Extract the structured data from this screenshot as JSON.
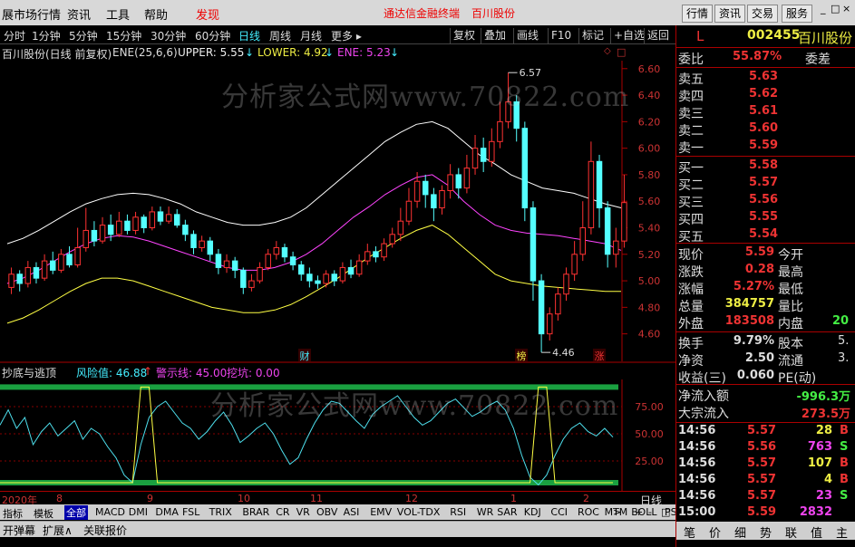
{
  "menubar": {
    "items": [
      "展市场行情",
      "资讯",
      "工具",
      "帮助"
    ],
    "discover": "发现",
    "terminal": "通达信金融终端",
    "stock_name": "百川股份",
    "right_buttons": [
      "行情",
      "资讯",
      "交易",
      "服务"
    ],
    "window_icons": [
      "_",
      "□",
      "×"
    ]
  },
  "periods": {
    "items": [
      "分时",
      "1分钟",
      "5分钟",
      "15分钟",
      "30分钟",
      "60分钟",
      "日线",
      "周线",
      "月线",
      "更多 ▸"
    ],
    "selected": "日线",
    "tools": [
      "复权",
      "叠加",
      "画线",
      "F10",
      "标记",
      "+自选",
      "返回"
    ]
  },
  "infobar": {
    "title": "百川股份(日线 前复权)",
    "indicator": "ENE(25,6,6)",
    "upper": "UPPER: 5.55",
    "lower": "LOWER: 4.92",
    "ene": "ENE: 5.23",
    "arrow": "↓"
  },
  "watermark": "分析家公式网www.70822.com",
  "sub_indicator": {
    "name": "抄底与逃顶",
    "risk": "风险值: 46.88",
    "risk_arrow": "↑",
    "warn": "警示线: 45.00",
    "dig": "挖坑: 0.00"
  },
  "dates": {
    "year": "2020年",
    "months": [
      "8",
      "9",
      "10",
      "11",
      "12",
      "1",
      "2"
    ],
    "period_label": "日线"
  },
  "indicators": [
    "指标",
    "模板",
    "全部",
    "MACD",
    "DMI",
    "DMA",
    "FSL",
    "TRIX",
    "BRAR",
    "CR",
    "VR",
    "OBV",
    "ASI",
    "EMV",
    "VOL-TDX",
    "RSI",
    "WR",
    "SAR",
    "KDJ",
    "CCI",
    "ROC",
    "MTM",
    "BOLL",
    "PSY"
  ],
  "indicator_selected": "全部",
  "indicator_nav": [
    ">",
    "+",
    "-",
    "□"
  ],
  "bottom_tabs": [
    "开弹幕",
    "扩展∧",
    "关联报价"
  ],
  "quote": {
    "mark": "L",
    "code": "002455",
    "name": "百川股份",
    "webi_label": "委比",
    "webi_value": "55.87%",
    "wecha_label": "委差",
    "sell": [
      [
        "卖五",
        "5.63"
      ],
      [
        "卖四",
        "5.62"
      ],
      [
        "卖三",
        "5.61"
      ],
      [
        "卖二",
        "5.60"
      ],
      [
        "卖一",
        "5.59"
      ]
    ],
    "buy": [
      [
        "买一",
        "5.58"
      ],
      [
        "买二",
        "5.57"
      ],
      [
        "买三",
        "5.56"
      ],
      [
        "买四",
        "5.55"
      ],
      [
        "买五",
        "5.54"
      ]
    ],
    "stats": [
      [
        "现价",
        "5.59",
        "今开",
        ""
      ],
      [
        "涨跌",
        "0.28",
        "最高",
        ""
      ],
      [
        "涨幅",
        "5.27%",
        "最低",
        ""
      ],
      [
        "总量",
        "384757",
        "量比",
        ""
      ],
      [
        "外盘",
        "183508",
        "内盘",
        "20"
      ]
    ],
    "stats2": [
      [
        "换手",
        "9.79%",
        "股本",
        "5."
      ],
      [
        "净资",
        "2.50",
        "流通",
        "3."
      ],
      [
        "收益(三)",
        "0.060",
        "PE(动)",
        ""
      ]
    ],
    "flows": [
      [
        "净流入额",
        "-996.3万"
      ],
      [
        "大宗流入",
        "273.5万"
      ]
    ],
    "ticks": [
      [
        "14:56",
        "5.57",
        "28",
        "B"
      ],
      [
        "14:56",
        "5.56",
        "763",
        "S"
      ],
      [
        "14:56",
        "5.57",
        "107",
        "B"
      ],
      [
        "14:56",
        "5.57",
        "4",
        "B"
      ],
      [
        "14:56",
        "5.57",
        "23",
        "S"
      ],
      [
        "15:00",
        "5.59",
        "2832",
        ""
      ]
    ],
    "bottom_tabs": [
      "笔",
      "价",
      "细",
      "势",
      "联",
      "值",
      "主"
    ]
  },
  "chart_data": [
    {
      "type": "candlestick",
      "title": "百川股份(日线 前复权)",
      "y_ticks": [
        4.6,
        4.8,
        5.0,
        5.2,
        5.4,
        5.6,
        5.8,
        6.0,
        6.2,
        6.4,
        6.6
      ],
      "ylim": [
        4.42,
        6.66
      ],
      "annotations": [
        {
          "label": "6.57",
          "value": 6.57
        },
        {
          "label": "4.46",
          "value": 4.46
        }
      ],
      "markers": [
        "财",
        "榜",
        "涨"
      ],
      "candles": [
        [
          4.95,
          5.05,
          5.1,
          4.9
        ],
        [
          5.05,
          4.98,
          5.08,
          4.92
        ],
        [
          4.98,
          5.1,
          5.15,
          4.95
        ],
        [
          5.1,
          5.02,
          5.14,
          4.98
        ],
        [
          5.02,
          5.15,
          5.2,
          5.0
        ],
        [
          5.15,
          5.08,
          5.22,
          5.05
        ],
        [
          5.08,
          5.2,
          5.24,
          5.06
        ],
        [
          5.2,
          5.12,
          5.26,
          5.1
        ],
        [
          5.12,
          5.25,
          5.4,
          5.1
        ],
        [
          5.25,
          5.38,
          5.55,
          5.22
        ],
        [
          5.38,
          5.3,
          5.45,
          5.26
        ],
        [
          5.3,
          5.42,
          5.48,
          5.28
        ],
        [
          5.42,
          5.35,
          5.5,
          5.3
        ],
        [
          5.35,
          5.45,
          5.52,
          5.33
        ],
        [
          5.45,
          5.38,
          5.5,
          5.35
        ],
        [
          5.38,
          5.48,
          5.52,
          5.35
        ],
        [
          5.48,
          5.4,
          5.5,
          5.36
        ],
        [
          5.4,
          5.52,
          5.56,
          5.38
        ],
        [
          5.52,
          5.45,
          5.56,
          5.42
        ],
        [
          5.45,
          5.5,
          5.56,
          5.43
        ],
        [
          5.5,
          5.42,
          5.54,
          5.4
        ],
        [
          5.42,
          5.35,
          5.46,
          5.3
        ],
        [
          5.35,
          5.25,
          5.38,
          5.2
        ],
        [
          5.25,
          5.3,
          5.34,
          5.22
        ],
        [
          5.3,
          5.2,
          5.33,
          5.15
        ],
        [
          5.2,
          5.1,
          5.24,
          5.05
        ],
        [
          5.1,
          5.15,
          5.2,
          5.06
        ],
        [
          5.15,
          5.08,
          5.18,
          5.02
        ],
        [
          5.08,
          4.95,
          5.1,
          4.9
        ],
        [
          4.95,
          5.0,
          5.05,
          4.92
        ],
        [
          5.0,
          5.1,
          5.14,
          4.98
        ],
        [
          5.1,
          5.2,
          5.24,
          5.08
        ],
        [
          5.2,
          5.25,
          5.3,
          5.16
        ],
        [
          5.25,
          5.18,
          5.28,
          5.14
        ],
        [
          5.18,
          5.12,
          5.22,
          5.08
        ],
        [
          5.12,
          5.05,
          5.15,
          5.0
        ],
        [
          5.05,
          5.0,
          5.1,
          4.95
        ],
        [
          5.0,
          4.98,
          5.04,
          4.94
        ],
        [
          4.98,
          5.05,
          5.08,
          4.95
        ],
        [
          5.05,
          5.0,
          5.08,
          4.96
        ],
        [
          5.0,
          5.1,
          5.14,
          4.98
        ],
        [
          5.1,
          5.05,
          5.16,
          5.02
        ],
        [
          5.05,
          5.15,
          5.2,
          5.03
        ],
        [
          5.15,
          5.22,
          5.28,
          5.12
        ],
        [
          5.22,
          5.18,
          5.26,
          5.14
        ],
        [
          5.18,
          5.28,
          5.32,
          5.15
        ],
        [
          5.28,
          5.35,
          5.4,
          5.25
        ],
        [
          5.35,
          5.45,
          5.55,
          5.3
        ],
        [
          5.45,
          5.6,
          5.7,
          5.42
        ],
        [
          5.6,
          5.75,
          5.82,
          5.55
        ],
        [
          5.75,
          5.65,
          5.8,
          5.55
        ],
        [
          5.65,
          5.55,
          5.7,
          5.45
        ],
        [
          5.55,
          5.68,
          5.72,
          5.5
        ],
        [
          5.68,
          5.8,
          5.88,
          5.62
        ],
        [
          5.8,
          5.7,
          5.85,
          5.62
        ],
        [
          5.7,
          5.85,
          5.95,
          5.66
        ],
        [
          5.85,
          6.0,
          6.1,
          5.8
        ],
        [
          6.0,
          5.9,
          6.08,
          5.82
        ],
        [
          5.9,
          6.05,
          6.15,
          5.86
        ],
        [
          6.05,
          6.2,
          6.35,
          6.0
        ],
        [
          6.2,
          6.35,
          6.57,
          6.15
        ],
        [
          6.35,
          6.15,
          6.4,
          6.05
        ],
        [
          6.15,
          5.55,
          6.2,
          5.45
        ],
        [
          5.55,
          5.0,
          5.6,
          4.85
        ],
        [
          5.0,
          4.6,
          5.05,
          4.46
        ],
        [
          4.6,
          4.75,
          4.8,
          4.55
        ],
        [
          4.75,
          4.9,
          4.95,
          4.7
        ],
        [
          4.9,
          5.05,
          5.1,
          4.85
        ],
        [
          5.05,
          5.2,
          5.3,
          5.0
        ],
        [
          5.2,
          5.4,
          5.6,
          5.15
        ],
        [
          5.4,
          5.9,
          6.05,
          5.35
        ],
        [
          5.9,
          5.55,
          5.95,
          5.4
        ],
        [
          5.55,
          5.2,
          5.6,
          5.1
        ],
        [
          5.2,
          5.3,
          5.4,
          5.1
        ],
        [
          5.3,
          5.59,
          5.8,
          5.25
        ]
      ],
      "series": [
        {
          "name": "UPPER",
          "color": "#ffffff",
          "values": [
            5.28,
            5.32,
            5.38,
            5.45,
            5.52,
            5.58,
            5.62,
            5.65,
            5.66,
            5.65,
            5.62,
            5.58,
            5.52,
            5.48,
            5.44,
            5.42,
            5.42,
            5.44,
            5.48,
            5.55,
            5.65,
            5.75,
            5.85,
            5.95,
            6.05,
            6.12,
            6.18,
            6.2,
            6.15,
            6.05,
            5.95,
            5.88,
            5.8,
            5.75,
            5.7,
            5.68,
            5.66,
            5.62,
            5.58,
            5.55
          ]
        },
        {
          "name": "ENE",
          "color": "#ff44ff",
          "values": [
            4.98,
            5.02,
            5.08,
            5.15,
            5.22,
            5.28,
            5.32,
            5.34,
            5.33,
            5.3,
            5.26,
            5.22,
            5.18,
            5.14,
            5.1,
            5.08,
            5.08,
            5.1,
            5.14,
            5.2,
            5.28,
            5.38,
            5.48,
            5.56,
            5.65,
            5.72,
            5.78,
            5.8,
            5.72,
            5.6,
            5.5,
            5.42,
            5.38,
            5.36,
            5.35,
            5.34,
            5.32,
            5.3,
            5.28,
            5.23
          ]
        },
        {
          "name": "LOWER",
          "color": "#ffff44",
          "values": [
            4.68,
            4.72,
            4.78,
            4.85,
            4.92,
            4.98,
            5.02,
            5.02,
            5.0,
            4.96,
            4.92,
            4.88,
            4.84,
            4.8,
            4.78,
            4.76,
            4.76,
            4.78,
            4.82,
            4.88,
            4.95,
            5.02,
            5.1,
            5.18,
            5.25,
            5.32,
            5.38,
            5.42,
            5.35,
            5.25,
            5.15,
            5.05,
            5.0,
            4.98,
            4.96,
            4.95,
            4.94,
            4.93,
            4.92,
            4.92
          ]
        }
      ]
    },
    {
      "type": "line",
      "title": "抄底与逃顶",
      "y_ticks": [
        25,
        50,
        75
      ],
      "ylim": [
        0,
        100
      ],
      "upper_band": 93,
      "lower_band": 5,
      "series": [
        {
          "name": "风险值",
          "color": "#4ee0ee",
          "values": [
            58,
            72,
            55,
            65,
            40,
            52,
            60,
            48,
            55,
            62,
            45,
            55,
            50,
            38,
            28,
            12,
            5,
            40,
            65,
            75,
            80,
            70,
            60,
            55,
            45,
            52,
            62,
            70,
            58,
            42,
            48,
            55,
            60,
            50,
            35,
            22,
            28,
            45,
            60,
            72,
            80,
            78,
            70,
            62,
            55,
            68,
            75,
            80,
            85,
            75,
            65,
            58,
            62,
            70,
            78,
            82,
            74,
            66,
            70,
            76,
            80,
            72,
            55,
            30,
            10,
            3,
            12,
            30,
            45,
            55,
            60,
            52,
            48,
            55,
            46.88
          ]
        },
        {
          "name": "警示线",
          "color": "#ffff44",
          "values": [
            5,
            5,
            5,
            5,
            5,
            5,
            5,
            5,
            5,
            5,
            5,
            5,
            5,
            5,
            5,
            5,
            5,
            93,
            93,
            5,
            5,
            5,
            5,
            5,
            5,
            5,
            5,
            5,
            5,
            5,
            5,
            5,
            5,
            5,
            5,
            5,
            5,
            5,
            5,
            5,
            5,
            5,
            5,
            5,
            5,
            5,
            5,
            5,
            5,
            5,
            5,
            5,
            5,
            5,
            5,
            5,
            5,
            5,
            5,
            5,
            5,
            5,
            5,
            5,
            5,
            93,
            93,
            5,
            5,
            5,
            5,
            5,
            5,
            5,
            5
          ]
        }
      ]
    }
  ]
}
